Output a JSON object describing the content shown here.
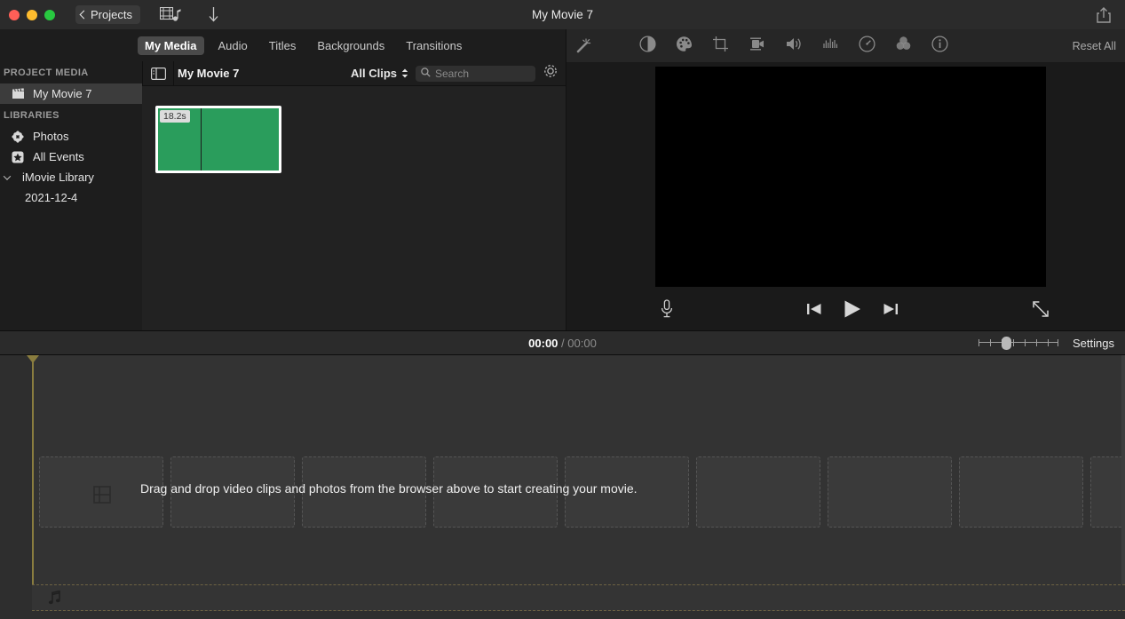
{
  "window": {
    "title": "My Movie 7",
    "projects_button": "Projects",
    "traffic_lights": [
      "close-red",
      "minimize-yellow",
      "zoom-green"
    ],
    "toolbar_icons": [
      "media-import-icon",
      "download-icon"
    ],
    "share_icon": "share-icon"
  },
  "media_tabs": [
    {
      "label": "My Media",
      "active": true
    },
    {
      "label": "Audio",
      "active": false
    },
    {
      "label": "Titles",
      "active": false
    },
    {
      "label": "Backgrounds",
      "active": false
    },
    {
      "label": "Transitions",
      "active": false
    }
  ],
  "sidebar": {
    "sections": [
      {
        "header": "PROJECT MEDIA",
        "items": [
          {
            "label": "My Movie 7",
            "icon": "clapperboard-icon",
            "selected": true
          }
        ]
      },
      {
        "header": "LIBRARIES",
        "items": [
          {
            "label": "Photos",
            "icon": "photos-flower-icon",
            "selected": false
          },
          {
            "label": "All Events",
            "icon": "star-badge-icon",
            "selected": false
          },
          {
            "label": "iMovie Library",
            "icon": "disclosure-chevron-icon",
            "selected": false,
            "expanded": true
          }
        ],
        "children": [
          {
            "label": "2021-12-4"
          }
        ]
      }
    ]
  },
  "browser": {
    "panel_toggle_icon": "sidebar-toggle-icon",
    "title": "My Movie 7",
    "filter": {
      "label": "All Clips",
      "icon": "up-down-chevron-icon"
    },
    "search": {
      "placeholder": "Search",
      "value": "",
      "icon": "search-icon"
    },
    "settings_gear_icon": "gear-icon",
    "clips": [
      {
        "duration": "18.2s",
        "color": "#2a9d5c",
        "selected": true
      }
    ]
  },
  "adjustments": {
    "wand_icon": "magic-wand-icon",
    "icons": [
      "color-balance-icon",
      "color-correction-palette-icon",
      "crop-icon",
      "stabilization-camera-icon",
      "volume-speaker-icon",
      "noise-reduction-equalizer-icon",
      "speed-gauge-icon",
      "filters-circles-icon",
      "clip-info-icon"
    ],
    "reset_all": "Reset All"
  },
  "preview": {
    "viewer_background": "#000000",
    "voiceover_icon": "microphone-icon",
    "transport": [
      {
        "name": "previous-clip-button",
        "icon": "skip-back-icon"
      },
      {
        "name": "play-button",
        "icon": "play-icon"
      },
      {
        "name": "next-clip-button",
        "icon": "skip-forward-icon"
      }
    ],
    "fullscreen_icon": "expand-arrows-icon"
  },
  "timeline_toolbar": {
    "current_time": "00:00",
    "separator": "/",
    "total_time": "00:00",
    "zoom_slider": {
      "value": 30,
      "ticks": 8
    },
    "settings_label": "Settings"
  },
  "timeline": {
    "drop_message": "Drag and drop video clips and photos from the browser above to start creating your movie.",
    "placeholder_count": 8,
    "film_icon": "film-frame-icon",
    "audio_track_icon": "music-note-icon",
    "playhead_color": "#8a7d3f",
    "playhead_position": 0
  }
}
